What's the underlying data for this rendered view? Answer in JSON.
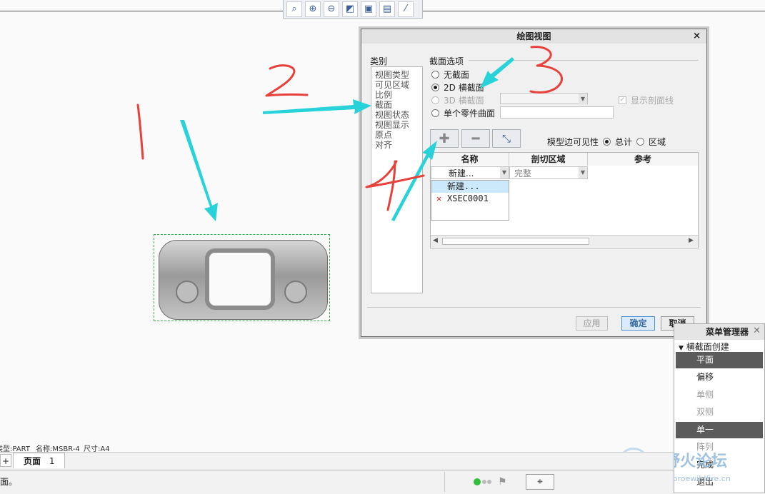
{
  "dialog": {
    "title": "绘图视图",
    "category_label": "类别",
    "categories": [
      "视图类型",
      "可见区域",
      "比例",
      "截面",
      "视图状态",
      "视图显示",
      "原点",
      "对齐"
    ],
    "section_options_label": "截面选项",
    "radio_none": "无截面",
    "radio_2d": "2D 横截面",
    "radio_3d": "3D 横截面",
    "radio_single_surface": "单个零件曲面",
    "show_hatch_label": "显示剖面线",
    "edge_visibility_label": "模型边可见性",
    "edge_total": "总计",
    "edge_region": "区域",
    "table_headers": [
      "名称",
      "剖切区域",
      "参考"
    ],
    "name_dropdown_value": "新建...",
    "region_dropdown_value": "完整",
    "dropdown_items": [
      "新建...",
      "XSEC0001"
    ],
    "apply_button": "应用",
    "ok_button": "确定",
    "cancel_button": "取消"
  },
  "menu_manager": {
    "title": "菜单管理器",
    "group_label": "横截面创建",
    "items": [
      "平面",
      "偏移",
      "单侧",
      "双侧",
      "单一",
      "阵列",
      "完成",
      "退出"
    ]
  },
  "info_bar": {
    "type": "类型:PART",
    "name": "名称:MSBR-4",
    "size": "尺寸:A4"
  },
  "page_tab": {
    "add_symbol": "+",
    "label": "页面",
    "number": "1"
  },
  "status": {
    "message": "截面。"
  },
  "annotations": [
    "1",
    "2",
    "3",
    "4"
  ],
  "watermark": {
    "name": "野火论坛",
    "url": "www.proewildfire.cn"
  }
}
